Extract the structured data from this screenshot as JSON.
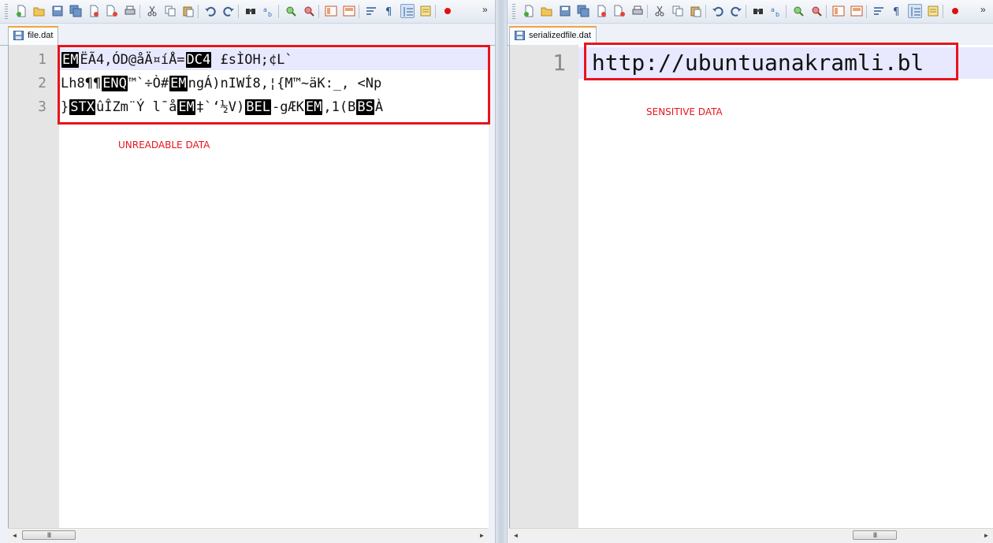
{
  "left": {
    "tab_label": "file.dat",
    "line_numbers": [
      "1",
      "2",
      "3"
    ],
    "lines": [
      [
        {
          "c": "EM"
        },
        {
          "t": "ËÃ4,ÓD@åÄ¤íÅ="
        },
        {
          "c": "DC4"
        },
        {
          "t": " £sÌOH;¢L`"
        }
      ],
      [
        {
          "t": "Lh8¶¶"
        },
        {
          "c": "ENQ"
        },
        {
          "t": "™`÷Ò#"
        },
        {
          "c": "EM"
        },
        {
          "t": "ngÁ)nIWÍ8,¦{M™~äK:_, <Np"
        }
      ],
      [
        {
          "t": "}"
        },
        {
          "c": "STX"
        },
        {
          "t": "ûÎZm¨Ý l¯å"
        },
        {
          "c": "EM"
        },
        {
          "t": "‡`‘½V)"
        },
        {
          "c": "BEL"
        },
        {
          "t": "-gÆK"
        },
        {
          "c": "EM"
        },
        {
          "t": ",1(B"
        },
        {
          "c": "BS"
        },
        {
          "t": "À"
        }
      ]
    ],
    "annotation": "UNREADABLE DATA"
  },
  "right": {
    "tab_label": "serializedfile.dat",
    "line_numbers": [
      "1"
    ],
    "lines": [
      [
        {
          "t": "¦http://ubuntuanakramli.bl"
        }
      ]
    ],
    "annotation": "SENSITIVE DATA"
  },
  "toolbar": {
    "overflow_label": "»",
    "icons": [
      "new-file-icon",
      "open-file-icon",
      "save-icon",
      "save-all-icon",
      "close-icon",
      "close-all-icon",
      "print-icon",
      "cut-icon",
      "copy-icon",
      "paste-icon",
      "undo-icon",
      "redo-icon",
      "find-icon",
      "replace-icon",
      "zoom-in-icon",
      "zoom-out-icon",
      "sync-vertical-icon",
      "sync-horizontal-icon",
      "word-wrap-icon",
      "show-all-chars-icon",
      "indent-guide-icon",
      "document-map-icon",
      "record-macro-icon"
    ]
  },
  "scrollbar": {
    "left_arrow": "◄",
    "right_arrow": "►",
    "thumb_grip": "III"
  },
  "colors": {
    "annotation_red": "#e8141d",
    "current_line": "#e8e8ff",
    "gutter": "#e5e5e5",
    "tab_accent": "#f3a33c"
  }
}
